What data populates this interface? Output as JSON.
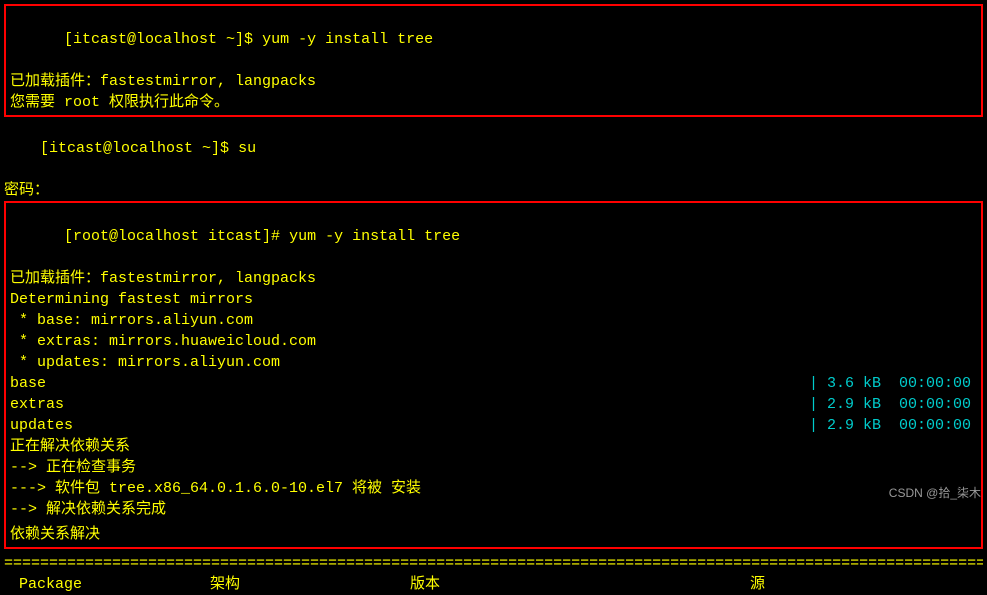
{
  "block1": {
    "prompt1": "[itcast@localhost ~]$ ",
    "cmd1": "yum -y install tree",
    "plugin_line": "已加载插件：fastestmirror, langpacks",
    "need_root": "您需要 root 权限执行此命令。"
  },
  "mid": {
    "prompt2": "[itcast@localhost ~]$ ",
    "cmd2": "su",
    "pwd_label": "密码："
  },
  "block2": {
    "prompt_root": "[root@localhost itcast]# ",
    "cmd_root": "yum -y install tree",
    "plugin_line2": "已加载插件：fastestmirror, langpacks",
    "determining": "Determining fastest mirrors",
    "mirror_base": " * base: mirrors.aliyun.com",
    "mirror_extras": " * extras: mirrors.huaweicloud.com",
    "mirror_updates": " * updates: mirrors.aliyun.com",
    "repo_base_name": "base",
    "repo_base_size": "| 3.6 kB  00:00:00",
    "repo_extras_name": "extras",
    "repo_extras_size": "| 2.9 kB  00:00:00",
    "repo_updates_name": "updates",
    "repo_updates_size": "| 2.9 kB  00:00:00",
    "resolving": "正在解决依赖关系",
    "check_trans": "--> 正在检查事务",
    "pkg_line": "---> 软件包 tree.x86_64.0.1.6.0-10.el7 将被 安装",
    "resolve_done": "--> 解决依赖关系完成",
    "deps_resolved": "依赖关系解决"
  },
  "divider": "=================================================================================================================================",
  "headers": {
    "package": " Package",
    "arch": "架构",
    "version": "版本",
    "source": "源"
  },
  "watermark": "CSDN @拾_柒木"
}
